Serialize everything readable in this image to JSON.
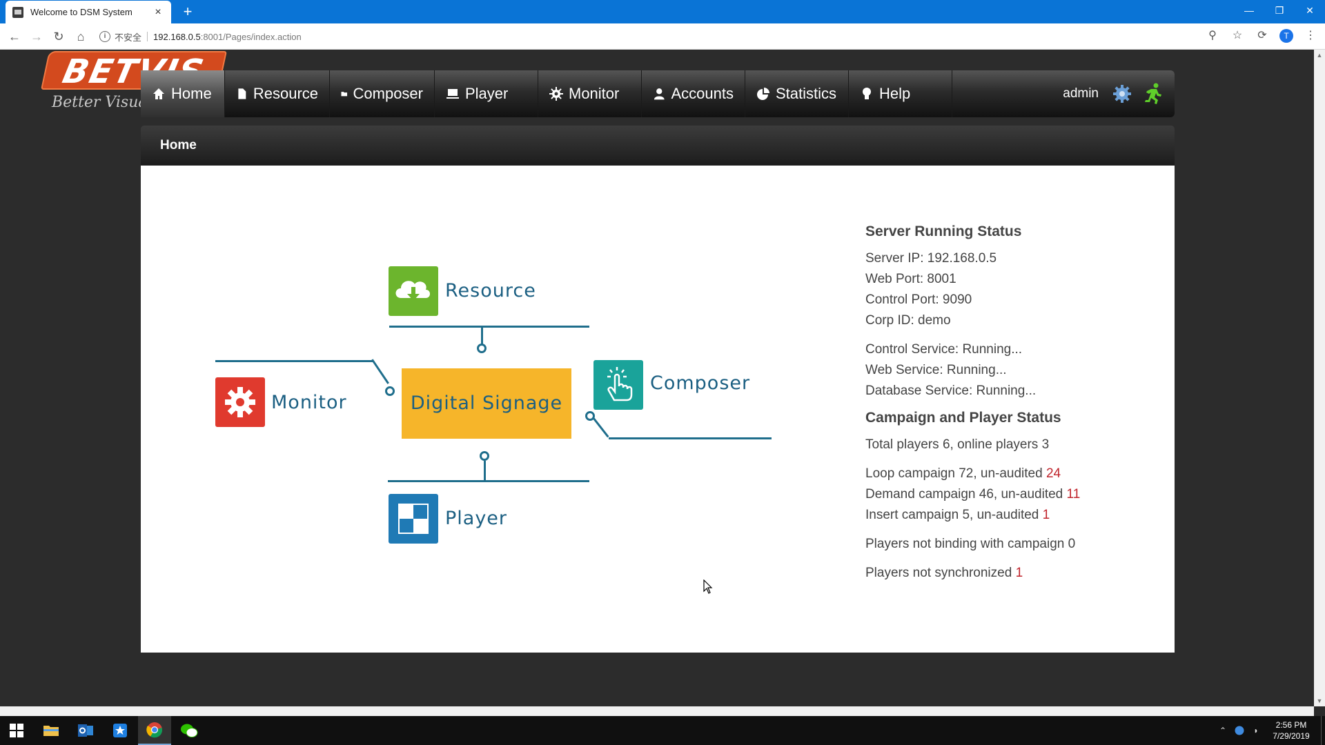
{
  "browser": {
    "tab_title": "Welcome to DSM System",
    "tab_close": "×",
    "new_tab": "+",
    "url_insecure_label": "不安全",
    "url_host": "192.168.0.5",
    "url_path": ":8001/Pages/index.action",
    "profile_initial": "T"
  },
  "logo": {
    "main": "BETVIS",
    "tagline": "Better Visual"
  },
  "nav": {
    "items": [
      {
        "label": "Home",
        "icon": "home-icon"
      },
      {
        "label": "Resource",
        "icon": "file-icon"
      },
      {
        "label": "Composer",
        "icon": "folder-icon"
      },
      {
        "label": "Player",
        "icon": "monitor-icon"
      },
      {
        "label": "Monitor",
        "icon": "gear-icon"
      },
      {
        "label": "Accounts",
        "icon": "user-icon"
      },
      {
        "label": "Statistics",
        "icon": "pie-chart-icon"
      },
      {
        "label": "Help",
        "icon": "lightbulb-icon"
      }
    ],
    "user": "admin"
  },
  "breadcrumb": "Home",
  "diagram": {
    "center": "Digital Signage",
    "resource": "Resource",
    "monitor": "Monitor",
    "composer": "Composer",
    "player": "Player",
    "colors": {
      "resource": "#6cb52d",
      "monitor": "#e03a2e",
      "composer": "#1aa39a",
      "player": "#1f7ab5",
      "center": "#f6b52a",
      "line": "#1f6e8c"
    }
  },
  "status": {
    "server_heading": "Server Running Status",
    "server_ip": "Server IP: 192.168.0.5",
    "web_port": "Web Port: 8001",
    "control_port": "Control Port: 9090",
    "corp_id": "Corp ID: demo",
    "control_service": "Control Service: Running...",
    "web_service": "Web Service: Running...",
    "database_service": "Database Service: Running...",
    "campaign_heading": "Campaign and Player Status",
    "players": "Total players 6, online players 3",
    "loop_text": "Loop campaign 72, un-audited ",
    "loop_unaudited": "24",
    "demand_text": "Demand campaign 46, un-audited ",
    "demand_unaudited": "11",
    "insert_text": "Insert campaign 5, un-audited ",
    "insert_unaudited": "1",
    "not_binding": "Players not binding with campaign 0",
    "not_sync_text": "Players not synchronized ",
    "not_sync_count": "1"
  },
  "taskbar": {
    "time": "2:56 PM",
    "date": "7/29/2019"
  }
}
